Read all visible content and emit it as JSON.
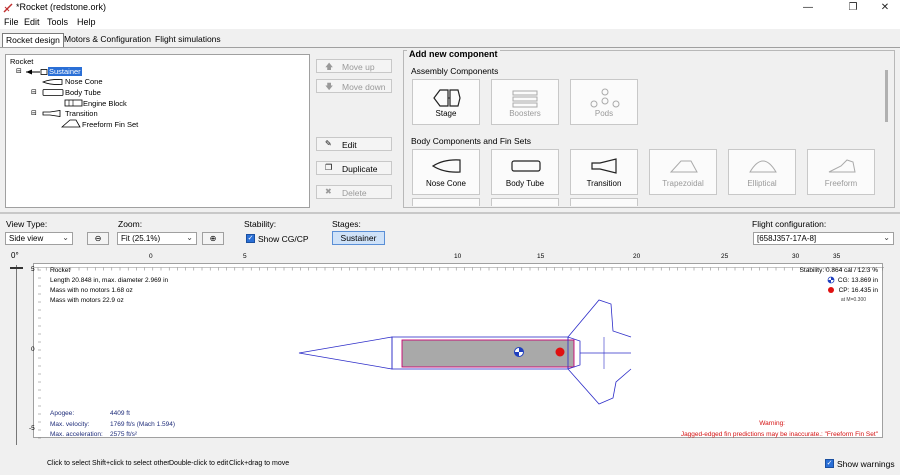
{
  "window": {
    "title": "*Rocket (redstone.ork)",
    "icon": "rocket-app-icon",
    "controls": [
      "minimize-icon",
      "maximize-icon",
      "close-icon"
    ]
  },
  "menu": [
    "File",
    "Edit",
    "Tools",
    "Help"
  ],
  "tabs": [
    {
      "label": "Rocket design",
      "active": true
    },
    {
      "label": "Motors & Configuration",
      "active": false
    },
    {
      "label": "Flight simulations",
      "active": false
    }
  ],
  "tree": {
    "root": "Rocket",
    "stage": "Sustainer",
    "items": [
      "Nose Cone",
      "Body Tube",
      "Engine Block",
      "Transition",
      "Freeform Fin Set"
    ]
  },
  "side_buttons": {
    "move_up": "Move up",
    "move_down": "Move down",
    "edit": "Edit",
    "duplicate": "Duplicate",
    "delete": "Delete"
  },
  "add_component": {
    "title": "Add new component",
    "assembly_title": "Assembly Components",
    "assembly": [
      {
        "label": "Stage",
        "enabled": true,
        "icon": "stage-icon"
      },
      {
        "label": "Boosters",
        "enabled": false,
        "icon": "boosters-icon"
      },
      {
        "label": "Pods",
        "enabled": false,
        "icon": "pods-icon"
      }
    ],
    "body_title": "Body Components and Fin Sets",
    "body": [
      {
        "label": "Nose Cone",
        "enabled": true,
        "icon": "nose-cone-icon"
      },
      {
        "label": "Body Tube",
        "enabled": true,
        "icon": "body-tube-icon"
      },
      {
        "label": "Transition",
        "enabled": true,
        "icon": "transition-icon"
      },
      {
        "label": "Trapezoidal",
        "enabled": false,
        "icon": "trapezoidal-fin-icon"
      },
      {
        "label": "Elliptical",
        "enabled": false,
        "icon": "elliptical-fin-icon"
      },
      {
        "label": "Freeform",
        "enabled": false,
        "icon": "freeform-fin-icon"
      }
    ]
  },
  "controls": {
    "view_type_label": "View Type:",
    "view_type_value": "Side view",
    "zoom_label": "Zoom:",
    "zoom_value": "Fit (25.1%)",
    "stability_label": "Stability:",
    "show_cgcp": "Show CG/CP",
    "show_cgcp_checked": true,
    "stages_label": "Stages:",
    "stage_button": "Sustainer",
    "flight_config_label": "Flight configuration:",
    "flight_config_value": "[658J357-17A-8]"
  },
  "rotation": "0°",
  "ruler": {
    "top_labels": [
      "0",
      "5",
      "10",
      "15",
      "20",
      "25",
      "30",
      "35"
    ],
    "left_labels": [
      "5",
      "0",
      "-5"
    ]
  },
  "figure": {
    "name": "Rocket",
    "info": [
      "Length 20.848 in, max. diameter 2.969 in",
      "Mass with no motors 1.68 oz",
      "Mass with motors 22.9 oz"
    ],
    "stability": "Stability: 0.864 cal / 12.3 %",
    "cg": "CG: 13.869 in",
    "cp": "CP: 16.435 in",
    "mach": "at M=0.300",
    "apogee_label": "Apogee:",
    "apogee_value": "4409 ft",
    "velocity_label": "Max. velocity:",
    "velocity_value": "1769 ft/s  (Mach 1.594)",
    "accel_label": "Max. acceleration:",
    "accel_value": "2575 ft/s²",
    "warning_title": "Warning:",
    "warning_text": "Jagged-edged fin predictions may be inaccurate.: \"Freeform Fin Set\""
  },
  "status": {
    "hints": [
      "Click to select",
      "Shift+click to select other",
      "Double-click to edit",
      "Click+drag to move"
    ],
    "show_warnings": "Show warnings",
    "show_warnings_checked": true
  },
  "colors": {
    "rocket_outline": "#2c2cc8",
    "selected_outline": "#c80070",
    "body_fill": "#a9a9a9",
    "cp_marker": "#e01010",
    "cg_marker": "#1f3fbf",
    "stats_text": "#1f2d7a",
    "warning_text": "#d41010",
    "selection_highlight": "#2a6fd6"
  }
}
